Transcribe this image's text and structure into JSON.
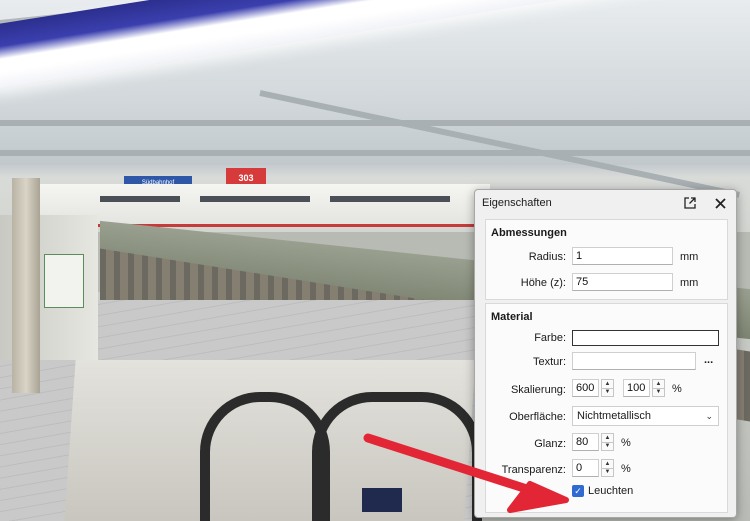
{
  "panel": {
    "title": "Eigenschaften",
    "sections": {
      "dimensions": {
        "title": "Abmessungen",
        "radius": {
          "label": "Radius:",
          "value": "1",
          "unit": "mm"
        },
        "height": {
          "label": "Höhe (z):",
          "value": "75",
          "unit": "mm"
        }
      },
      "material": {
        "title": "Material",
        "color": {
          "label": "Farbe:",
          "value": "#ffffff"
        },
        "texture": {
          "label": "Textur:",
          "value": "",
          "browse": "..."
        },
        "scale": {
          "label": "Skalierung:",
          "x": "600",
          "y": "100",
          "unit": "%"
        },
        "surface": {
          "label": "Oberfläche:",
          "selected": "Nichtmetallisch"
        },
        "gloss": {
          "label": "Glanz:",
          "value": "80",
          "unit": "%"
        },
        "transparency": {
          "label": "Transparenz:",
          "value": "0",
          "unit": "%"
        },
        "glow": {
          "label": "Leuchten",
          "checked": true
        }
      }
    }
  },
  "scene": {
    "station_sign": "Südbahnhof",
    "platform_sign": "303",
    "lamp_colors": [
      "#2c2f8e",
      "#ffffff"
    ]
  },
  "icons": {
    "popout": "external-link-icon",
    "close": "close-icon",
    "check": "checkmark-icon",
    "arrow": "red-arrow-annotation"
  },
  "colors": {
    "arrow": "#e32636",
    "checkbox": "#2f6bd1"
  }
}
